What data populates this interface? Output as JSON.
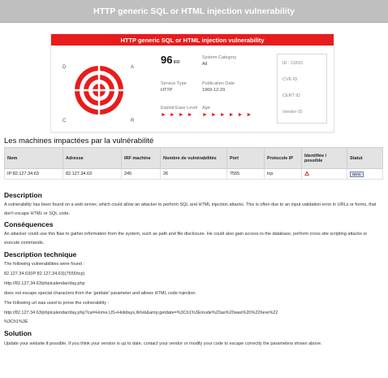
{
  "header": {
    "title": "HTTP generic SQL or HTML injection vulnerability"
  },
  "card": {
    "title": "HTTP generic SQL or HTML injection vulnerability",
    "target_labels": {
      "c": "C",
      "a": "A",
      "d": "D",
      "r": "R"
    },
    "score": "96",
    "score_unit": "IRF",
    "system_category_label": "System Category",
    "system_category_value": "All",
    "service_type_label": "Service Type",
    "service_type_value": "HTTP",
    "publication_date_label": "Publication Date",
    "publication_date_value": "1969-12-29",
    "exploit_ease_label": "Exploit Ease Level",
    "exploit_ease_value": "► ► ► ►",
    "age_label": "Age",
    "age_value": "► ► ► ► ► ►",
    "id_label": "ID : 11815",
    "cve_label": "CVE ID",
    "cert_label": "CERT ID",
    "vendor_label": "Vendor ID"
  },
  "machines": {
    "title": "Les machines impactées par la vulnérabilité",
    "columns": [
      "Nom",
      "Adresse",
      "IRF machine",
      "Nombre de vulnérabilités",
      "Port",
      "Protocole IP",
      "Identifiée / possible",
      "Statut"
    ],
    "rows": [
      {
        "nom": "IP:82.127.34.63",
        "adresse": "82.127.34.63",
        "irf": "245",
        "nb": "26",
        "port": "7555",
        "protocole": "tcp",
        "identifiee": "⚠",
        "statut": "NEW"
      }
    ]
  },
  "description": {
    "heading": "Description",
    "text": "A vulnerability has been found on a web server, which could allow an attacker to perform SQL and HTML injection attacks. This is often due to an input validation error in URLs or forms, that don't escape HTML or SQL code."
  },
  "consequences": {
    "heading": "Conséquences",
    "text": "An attacker could use this flaw to gather information from the system, such as path and file disclosure. He could also gain access to the database, perform cross site scripting attacks or execute commands."
  },
  "technique": {
    "heading": "Description technique",
    "line1": "The following vulnerabilities were found :",
    "line2": "82.127.34.63(IP:82.127.34.63)(7555/tcp)",
    "line3": "http://82.127.34.63/phpicalendar/day.php",
    "line4": " does not escape special characters from the 'getdate' parameter and allows HTML code injection.",
    "line5": "The following url was used to prove the vulnerability :",
    "line6": "http://82.127.34.63/phpicalendar/day.php?cal=Home,US+Holidays,Work&amp;getdate=%3Ch1%3Einode%20as%20was%20%22here%22",
    "line7": "%3Ch1%3E"
  },
  "solution": {
    "heading": "Solution",
    "text": "Update your website if possible. If you think your version is up to date, contact your vendor or modify your code to escape correctly the parameters shown above."
  },
  "colors": {
    "accent": "#e81c1c",
    "header_bg": "#bfbfbf",
    "table_head": "#e3e3e3"
  }
}
